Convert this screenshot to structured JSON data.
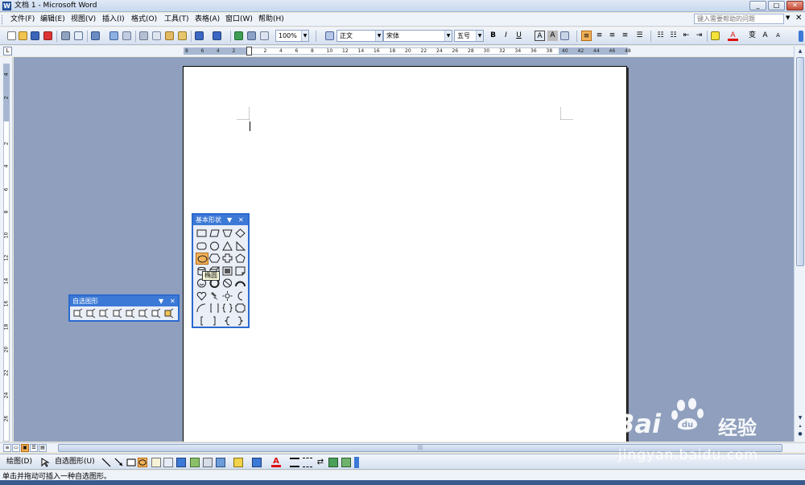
{
  "window": {
    "title": "文档 1 - Microsoft Word",
    "buttons": [
      "_",
      "□",
      "✕"
    ]
  },
  "menu": {
    "items": [
      "文件(F)",
      "编辑(E)",
      "视图(V)",
      "插入(I)",
      "格式(O)",
      "工具(T)",
      "表格(A)",
      "窗口(W)",
      "帮助(H)"
    ],
    "help_placeholder": "键入需要帮助的问题"
  },
  "toolbar": {
    "zoom": "100%",
    "style": "正文",
    "font": "宋体",
    "size": "五号",
    "bold": "B",
    "italic": "I",
    "underline": "U",
    "char_border": "A",
    "char_shading": "A"
  },
  "ruler": {
    "h_ticks": [
      "8",
      "6",
      "4",
      "2",
      "",
      "2",
      "4",
      "6",
      "8",
      "10",
      "12",
      "14",
      "16",
      "18",
      "20",
      "22",
      "24",
      "26",
      "28",
      "30",
      "32",
      "34",
      "36",
      "38",
      "40",
      "42",
      "44",
      "46",
      "48"
    ],
    "v_ticks": [
      "4",
      "2",
      "",
      "2",
      "4",
      "6",
      "8",
      "10",
      "12",
      "14",
      "16",
      "18",
      "20",
      "22",
      "24",
      "26"
    ],
    "corner_label": "L"
  },
  "basic_shapes_palette": {
    "title": "基本形状",
    "tooltip": "椭圆",
    "shapes": [
      "rectangle",
      "parallelogram",
      "trapezoid",
      "diamond",
      "rounded-rectangle",
      "octagon",
      "triangle",
      "right-triangle",
      "oval",
      "hexagon",
      "cross",
      "pentagon",
      "can",
      "cube",
      "bevel",
      "folded-corner",
      "smiley",
      "donut",
      "no-symbol",
      "block-arc",
      "heart",
      "lightning-bolt",
      "sun",
      "moon",
      "arc",
      "double-bracket",
      "double-brace",
      "plaque",
      "left-bracket",
      "right-bracket",
      "left-brace",
      "right-brace"
    ]
  },
  "autoshapes_palette": {
    "title": "自选图形",
    "items": [
      "lines",
      "connectors",
      "basic-shapes",
      "block-arrows",
      "flowchart",
      "stars-banners",
      "callouts",
      "more-autoshapes"
    ]
  },
  "drawing_toolbar": {
    "draw": "绘图(D)",
    "autoshapes": "自选图形(U)"
  },
  "statusbar": {
    "text": "单击并拖动可插入一种自选图形。"
  },
  "watermark": {
    "brand": "Bai",
    "brand2": "du",
    "product": "经验",
    "url": "jingyan.baidu.com"
  },
  "colors": {
    "accent": "#3c79d6",
    "highlight": "#f3b25a",
    "workspace": "#8f9fbd"
  }
}
